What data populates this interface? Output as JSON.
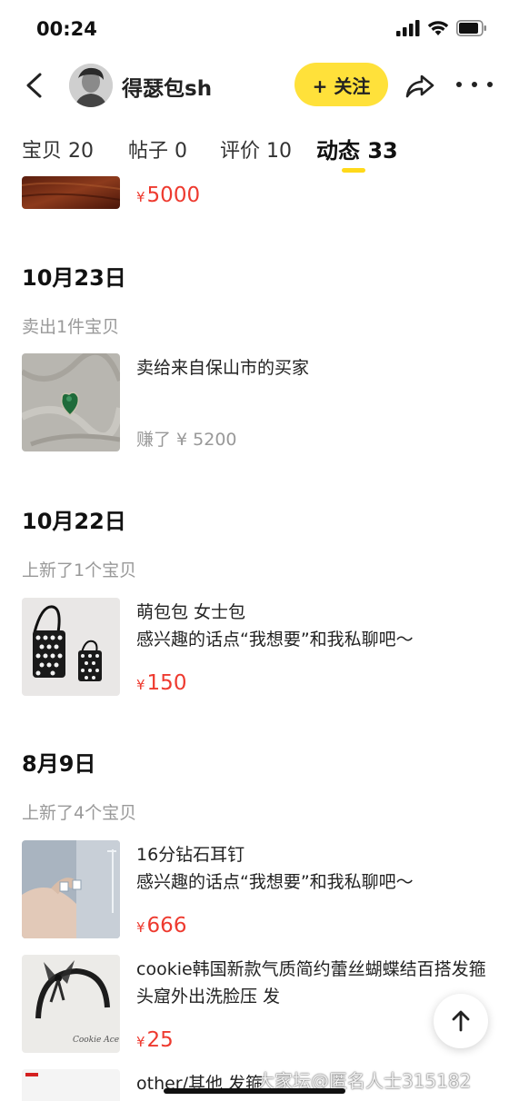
{
  "status": {
    "time": "00:24"
  },
  "header": {
    "seller_name": "得瑟包sh",
    "follow_label": "+ 关注"
  },
  "tabs": [
    {
      "label": "宝贝 20"
    },
    {
      "label": "帖子 0"
    },
    {
      "label": "评价 10"
    },
    {
      "label": "动态 33",
      "active": true
    }
  ],
  "feed": {
    "partial_item": {
      "currency": "¥",
      "price": "5000"
    },
    "groups": [
      {
        "date": "10月23日",
        "action": "卖出1件宝贝",
        "items": [
          {
            "title": "卖给来自保山市的买家",
            "earned": "赚了 ¥ 5200"
          }
        ]
      },
      {
        "date": "10月22日",
        "action": "上新了1个宝贝",
        "items": [
          {
            "title": "萌包包 女士包",
            "desc": "感兴趣的话点“我想要”和我私聊吧～",
            "currency": "¥",
            "price": "150"
          }
        ]
      },
      {
        "date": "8月9日",
        "action": "上新了4个宝贝",
        "items": [
          {
            "title": "16分钻石耳钉",
            "desc": "感兴趣的话点“我想要”和我私聊吧～",
            "currency": "¥",
            "price": "666"
          },
          {
            "title": "cookie韩国新款气质简约蕾丝蝴蝶结百搭发箍头窟外出洗脸压 发",
            "currency": "¥",
            "price": "25"
          },
          {
            "title": "other/其他 发箍"
          }
        ]
      }
    ]
  },
  "thumb_caption": "Cookie Ace",
  "watermark": "大家坛@匿名人士315182",
  "colors": {
    "accent": "#ffe13a",
    "price": "#ee3a2f",
    "muted": "#999999"
  }
}
